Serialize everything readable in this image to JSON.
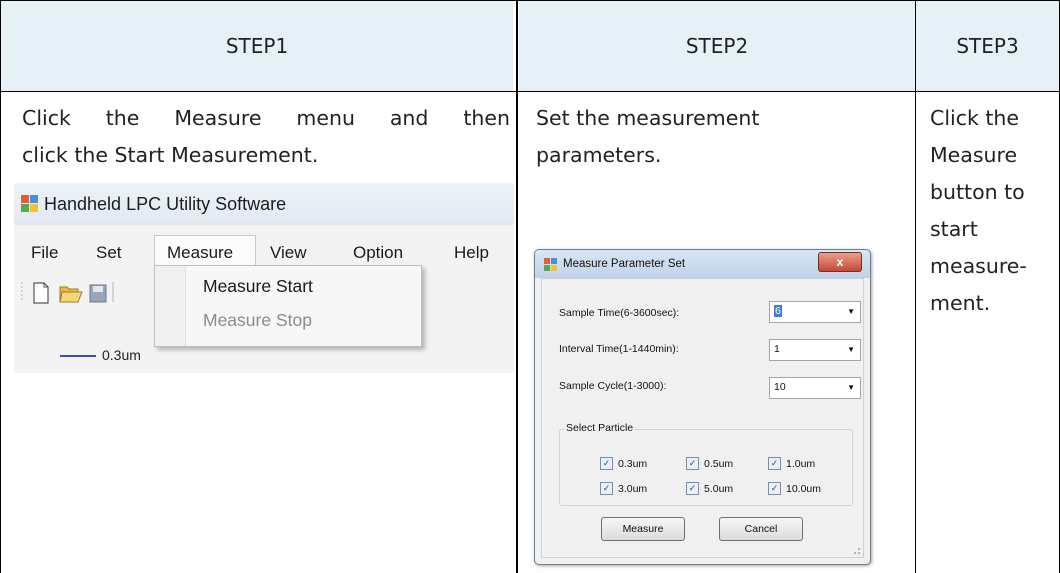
{
  "headers": [
    "STEP1",
    "STEP2",
    "STEP3"
  ],
  "step1": {
    "text_line1": "Click the Measure menu and then",
    "text_line2": "click the Start Measurement.",
    "app_title": "Handheld LPC Utility Software",
    "menu": [
      "File",
      "Set",
      "Measure",
      "View",
      "Option",
      "Help"
    ],
    "dropdown_items": [
      "Measure Start",
      "Measure Stop"
    ],
    "chart_legend": "0.3um"
  },
  "step2": {
    "text_line1": "Set the measurement",
    "text_line2": "parameters.",
    "dialog": {
      "title": "Measure Parameter Set",
      "close": "x",
      "params": [
        {
          "label": "Sample Time(6-3600sec):",
          "value": "6"
        },
        {
          "label": "Interval Time(1-1440min):",
          "value": "1"
        },
        {
          "label": "Sample Cycle(1-3000):",
          "value": "10"
        }
      ],
      "group_label": "Select Particle",
      "particles": [
        "0.3um",
        "0.5um",
        "1.0um",
        "3.0um",
        "5.0um",
        "10.0um"
      ],
      "measure_button": "Measure",
      "cancel_button": "Cancel"
    }
  },
  "step3": {
    "lines": [
      "Click the",
      "Measure",
      "button to",
      "start",
      "measure-",
      "ment."
    ]
  }
}
